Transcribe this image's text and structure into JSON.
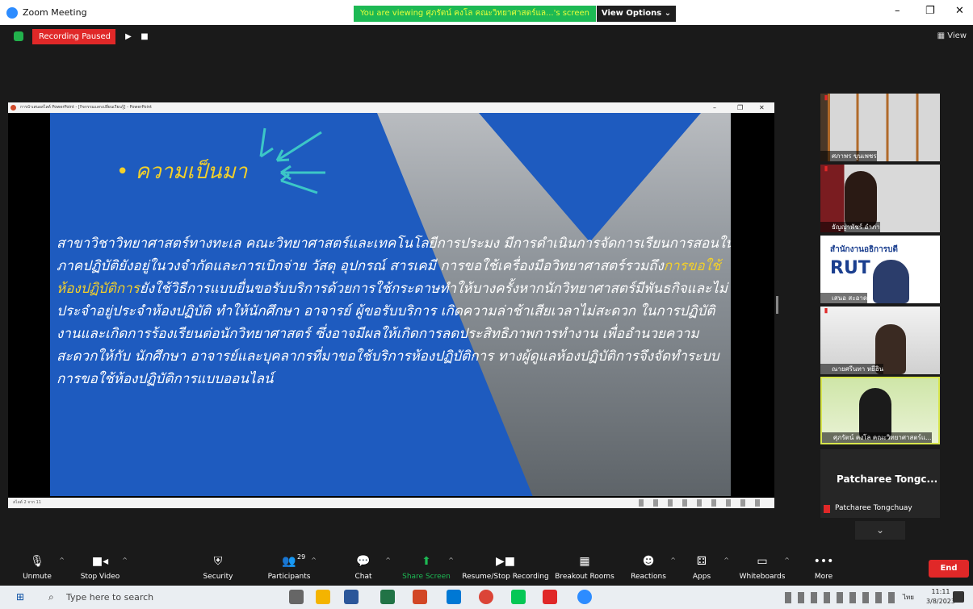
{
  "window": {
    "title": "Zoom Meeting",
    "minimize": "–",
    "restore": "❐",
    "close": "✕"
  },
  "banner": {
    "viewing": "You are viewing ศุภรัตน์ คงโล คณะวิทยาศาสตร์แล...'s screen",
    "view_options": "View Options  ⌄"
  },
  "recording": {
    "status": "Recording Paused",
    "play": "▶",
    "stop": "■",
    "view_label": "View"
  },
  "ppt": {
    "window_title": "การนำเสนอสไลด์ PowerPoint - [กิจกรรมแลกเปลี่ยนเรียนรู้] - PowerPoint",
    "minimize": "–",
    "restore": "❐",
    "close": "✕",
    "status": "สไลด์ 2 จาก 11",
    "slide": {
      "bullet": "• ความเป็นมา",
      "body_part1": "สาขาวิชาวิทยาศาสตร์ทางทะเล คณะวิทยาศาสตร์และเทคโนโลยีการประมง มีการดำเนินการจัดการเรียนการสอนในภาคปฏิบัติยังอยู่ในวงจำกัดและการเบิกจ่าย วัสดุ อุปกรณ์ สารเคมี การขอใช้เครื่องมือวิทยาศาสตร์รวมถึง",
      "body_highlight": "การขอใช้ห้องปฏิบัติการ",
      "body_part2": "ยังใช้วิธีการแบบยื่นขอรับบริการด้วยการใช้กระดาษทำให้บางครั้งหากนักวิทยาศาสตร์มีพันธกิจและไม่ประจำอยู่ประจำห้องปฏิบัติ ทำให้นักศึกษา อาจารย์ ผู้ขอรับบริการ เกิดความล่าช้าเสียเวลาไม่สะดวก ในการปฏิบัติงานและเกิดการร้องเรียนต่อนักวิทยาศาสตร์ ซึ่งอาจมีผลให้เกิดการลดประสิทธิภาพการทำงาน เพื่ออำนวยความสะดวกให้กับ นักศึกษา อาจารย์และบุคลากรที่มาขอใช้บริการห้องปฏิบัติการ ทางผู้ดูแลห้องปฏิบัติการจึงจัดทำระบบการขอใช้ห้องปฏิบัติการแบบออนไลน์"
    }
  },
  "participants_panel": {
    "tiles": [
      {
        "name": "ศภาพร ขุนเพชร"
      },
      {
        "name": "ธัญญาพัชร์ อำภา"
      },
      {
        "name": "เสนอ สะอาด",
        "header": "สำนักงานอธิการบดี",
        "logo": "RUT"
      },
      {
        "name": "ณายศรีนทา หยีฮิน"
      },
      {
        "name": "ศุภรัตน์ คงโล คณะวิทยาศาสตร์แ..."
      }
    ],
    "no_video": {
      "big": "Patcharee  Tongc...",
      "name": "Patcharee Tongchuay"
    },
    "more": "⌄"
  },
  "toolbar": {
    "unmute": "Unmute",
    "stop_video": "Stop Video",
    "security": "Security",
    "participants": "Participants",
    "participants_count": "29",
    "chat": "Chat",
    "share_screen": "Share Screen",
    "resume_stop_recording": "Resume/Stop Recording",
    "breakout_rooms": "Breakout Rooms",
    "reactions": "Reactions",
    "apps": "Apps",
    "whiteboards": "Whiteboards",
    "more": "More",
    "end": "End"
  },
  "taskbar": {
    "search_placeholder": "Type here to search",
    "lang": "ไทย",
    "time": "11:11",
    "date": "3/8/2023"
  },
  "colors": {
    "slide_blue": "#1e5bbf",
    "highlight_yellow": "#f3d02a",
    "rec_red": "#e02828",
    "zoom_green": "#1db954"
  }
}
